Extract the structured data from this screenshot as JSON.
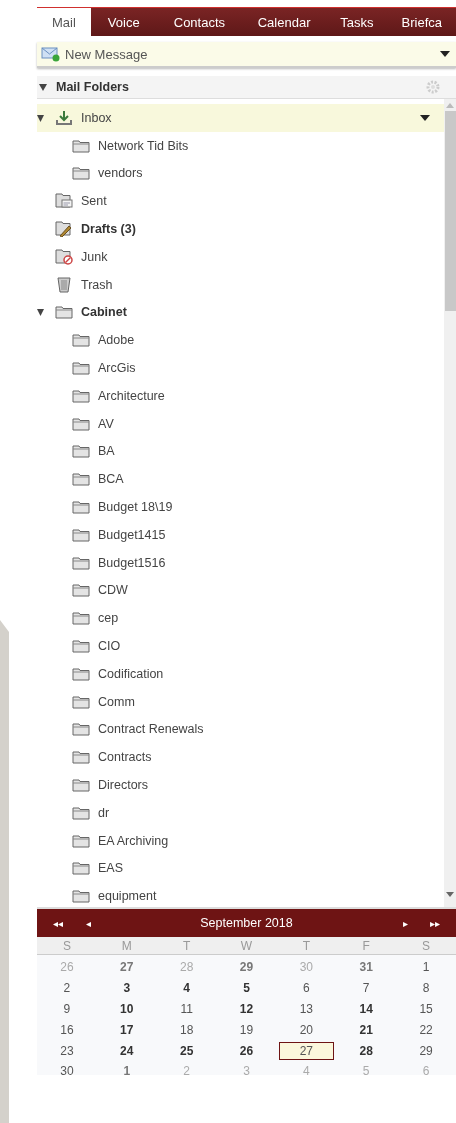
{
  "tabs": [
    {
      "label": "Mail",
      "selected": true
    },
    {
      "label": "Voice",
      "selected": false
    },
    {
      "label": "Contacts",
      "selected": false
    },
    {
      "label": "Calendar",
      "selected": false
    },
    {
      "label": "Tasks",
      "selected": false
    },
    {
      "label": "Briefca",
      "selected": false
    }
  ],
  "new_message": {
    "label": "New Message"
  },
  "folders": {
    "title": "Mail Folders",
    "expanded": true,
    "items": [
      {
        "name": "Inbox",
        "kind": "inbox",
        "bold": false,
        "selected": true,
        "expanded": true,
        "children": [
          {
            "name": "Network Tid Bits",
            "kind": "folder",
            "bold": false,
            "selected": false
          },
          {
            "name": "vendors",
            "kind": "folder",
            "bold": false,
            "selected": false
          }
        ]
      },
      {
        "name": "Sent",
        "kind": "sent",
        "bold": false,
        "selected": false
      },
      {
        "name": "Drafts (3)",
        "kind": "drafts",
        "bold": true,
        "selected": false
      },
      {
        "name": "Junk",
        "kind": "junk",
        "bold": false,
        "selected": false
      },
      {
        "name": "Trash",
        "kind": "trash",
        "bold": false,
        "selected": false
      },
      {
        "name": "Cabinet",
        "kind": "folder",
        "bold": true,
        "selected": false,
        "expanded": true,
        "children": [
          {
            "name": "Adobe",
            "kind": "folder",
            "bold": false,
            "selected": false
          },
          {
            "name": "ArcGis",
            "kind": "folder",
            "bold": false,
            "selected": false
          },
          {
            "name": "Architecture",
            "kind": "folder",
            "bold": false,
            "selected": false
          },
          {
            "name": "AV",
            "kind": "folder",
            "bold": false,
            "selected": false
          },
          {
            "name": "BA",
            "kind": "folder",
            "bold": false,
            "selected": false
          },
          {
            "name": "BCA",
            "kind": "folder",
            "bold": false,
            "selected": false
          },
          {
            "name": "Budget 18\\19",
            "kind": "folder",
            "bold": false,
            "selected": false
          },
          {
            "name": "Budget1415",
            "kind": "folder",
            "bold": false,
            "selected": false
          },
          {
            "name": "Budget1516",
            "kind": "folder",
            "bold": false,
            "selected": false
          },
          {
            "name": "CDW",
            "kind": "folder",
            "bold": false,
            "selected": false
          },
          {
            "name": "cep",
            "kind": "folder",
            "bold": false,
            "selected": false
          },
          {
            "name": "CIO",
            "kind": "folder",
            "bold": false,
            "selected": false
          },
          {
            "name": "Codification",
            "kind": "folder",
            "bold": false,
            "selected": false
          },
          {
            "name": "Comm",
            "kind": "folder",
            "bold": false,
            "selected": false
          },
          {
            "name": "Contract Renewals",
            "kind": "folder",
            "bold": false,
            "selected": false
          },
          {
            "name": "Contracts",
            "kind": "folder",
            "bold": false,
            "selected": false
          },
          {
            "name": "Directors",
            "kind": "folder",
            "bold": false,
            "selected": false
          },
          {
            "name": "dr",
            "kind": "folder",
            "bold": false,
            "selected": false
          },
          {
            "name": "EA Archiving",
            "kind": "folder",
            "bold": false,
            "selected": false
          },
          {
            "name": "EAS",
            "kind": "folder",
            "bold": false,
            "selected": false
          },
          {
            "name": "equipment",
            "kind": "folder",
            "bold": false,
            "selected": false
          }
        ]
      }
    ]
  },
  "calendar": {
    "title": "September 2018",
    "nav": [
      "◂◂",
      "◂",
      "▸",
      "▸▸"
    ],
    "weekdays": [
      "S",
      "M",
      "T",
      "W",
      "T",
      "F",
      "S"
    ],
    "weeks": [
      [
        {
          "d": "26",
          "other": true,
          "bold": false,
          "selected": false
        },
        {
          "d": "27",
          "other": true,
          "bold": true,
          "selected": false
        },
        {
          "d": "28",
          "other": true,
          "bold": false,
          "selected": false
        },
        {
          "d": "29",
          "other": true,
          "bold": true,
          "selected": false
        },
        {
          "d": "30",
          "other": true,
          "bold": false,
          "selected": false
        },
        {
          "d": "31",
          "other": true,
          "bold": true,
          "selected": false
        },
        {
          "d": "1",
          "other": false,
          "bold": false,
          "selected": false
        }
      ],
      [
        {
          "d": "2",
          "other": false,
          "bold": false,
          "selected": false
        },
        {
          "d": "3",
          "other": false,
          "bold": true,
          "selected": false
        },
        {
          "d": "4",
          "other": false,
          "bold": true,
          "selected": false
        },
        {
          "d": "5",
          "other": false,
          "bold": true,
          "selected": false
        },
        {
          "d": "6",
          "other": false,
          "bold": false,
          "selected": false
        },
        {
          "d": "7",
          "other": false,
          "bold": false,
          "selected": false
        },
        {
          "d": "8",
          "other": false,
          "bold": false,
          "selected": false
        }
      ],
      [
        {
          "d": "9",
          "other": false,
          "bold": false,
          "selected": false
        },
        {
          "d": "10",
          "other": false,
          "bold": true,
          "selected": false
        },
        {
          "d": "11",
          "other": false,
          "bold": false,
          "selected": false
        },
        {
          "d": "12",
          "other": false,
          "bold": true,
          "selected": false
        },
        {
          "d": "13",
          "other": false,
          "bold": false,
          "selected": false
        },
        {
          "d": "14",
          "other": false,
          "bold": true,
          "selected": false
        },
        {
          "d": "15",
          "other": false,
          "bold": false,
          "selected": false
        }
      ],
      [
        {
          "d": "16",
          "other": false,
          "bold": false,
          "selected": false
        },
        {
          "d": "17",
          "other": false,
          "bold": true,
          "selected": false
        },
        {
          "d": "18",
          "other": false,
          "bold": false,
          "selected": false
        },
        {
          "d": "19",
          "other": false,
          "bold": false,
          "selected": false
        },
        {
          "d": "20",
          "other": false,
          "bold": false,
          "selected": false
        },
        {
          "d": "21",
          "other": false,
          "bold": true,
          "selected": false
        },
        {
          "d": "22",
          "other": false,
          "bold": false,
          "selected": false
        }
      ],
      [
        {
          "d": "23",
          "other": false,
          "bold": false,
          "selected": false
        },
        {
          "d": "24",
          "other": false,
          "bold": true,
          "selected": false
        },
        {
          "d": "25",
          "other": false,
          "bold": true,
          "selected": false
        },
        {
          "d": "26",
          "other": false,
          "bold": true,
          "selected": false
        },
        {
          "d": "27",
          "other": false,
          "bold": false,
          "selected": true
        },
        {
          "d": "28",
          "other": false,
          "bold": true,
          "selected": false
        },
        {
          "d": "29",
          "other": false,
          "bold": false,
          "selected": false
        }
      ],
      [
        {
          "d": "30",
          "other": false,
          "bold": false,
          "selected": false
        },
        {
          "d": "1",
          "other": true,
          "bold": true,
          "selected": false
        },
        {
          "d": "2",
          "other": true,
          "bold": false,
          "selected": false
        },
        {
          "d": "3",
          "other": true,
          "bold": false,
          "selected": false
        },
        {
          "d": "4",
          "other": true,
          "bold": false,
          "selected": false
        },
        {
          "d": "5",
          "other": true,
          "bold": false,
          "selected": false
        },
        {
          "d": "6",
          "other": true,
          "bold": false,
          "selected": false
        }
      ]
    ]
  }
}
